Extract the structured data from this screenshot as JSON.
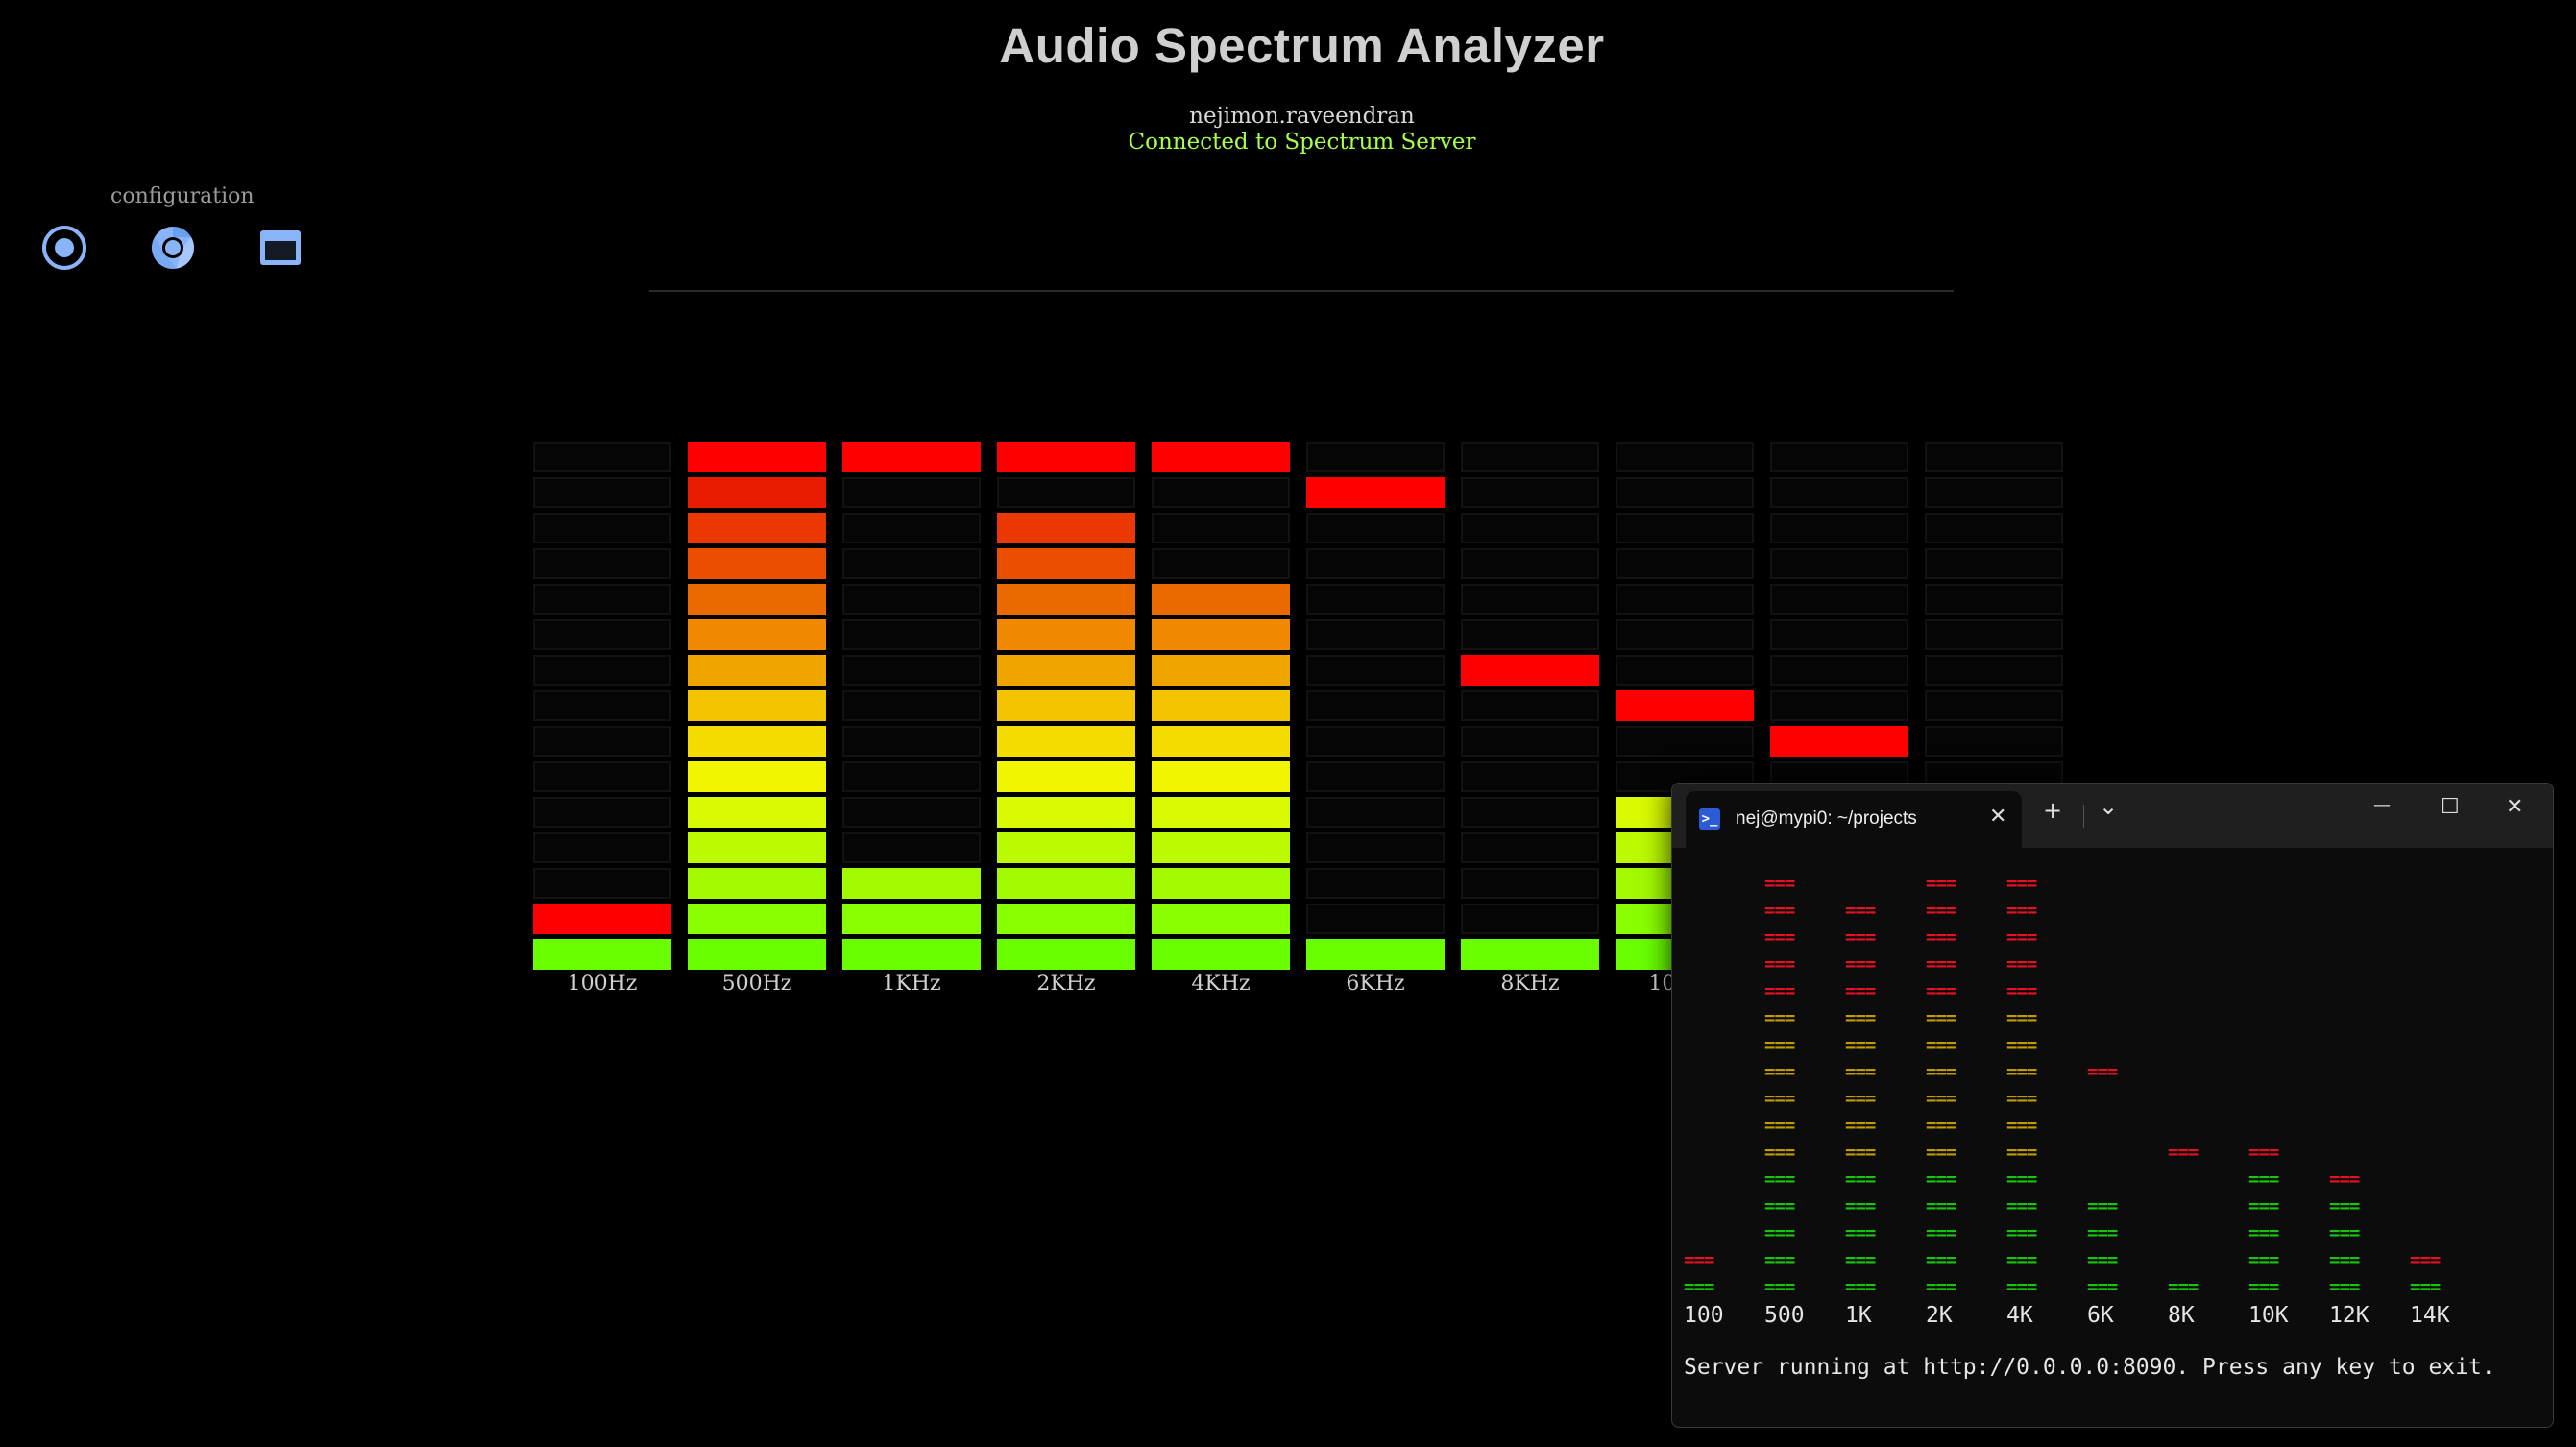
{
  "page": {
    "title": "Audio Spectrum Analyzer",
    "user": "nejimon.raveendran",
    "status": "Connected to Spectrum Server",
    "status_color": "#a6ff4d"
  },
  "config": {
    "label": "configuration",
    "icons": [
      "record-icon",
      "chrome-icon",
      "window-icon"
    ],
    "icon_color": "#8ab4f8"
  },
  "analyzer": {
    "segments_per_band": 15,
    "bands": [
      {
        "label": "100Hz",
        "level": 1,
        "peak": 2
      },
      {
        "label": "500Hz",
        "level": 15,
        "peak": 15
      },
      {
        "label": "1KHz",
        "level": 3,
        "peak": 15
      },
      {
        "label": "2KHz",
        "level": 13,
        "peak": 15
      },
      {
        "label": "4KHz",
        "level": 11,
        "peak": 15
      },
      {
        "label": "6KHz",
        "level": 1,
        "peak": 14
      },
      {
        "label": "8KHz",
        "level": 1,
        "peak": 9
      },
      {
        "label": "10KHz",
        "level": 5,
        "peak": 8
      },
      {
        "label": "12KHz",
        "level": 0,
        "peak": 7
      },
      {
        "label": "14KHz",
        "level": 0,
        "peak": 0
      }
    ],
    "peak_color": "#ff0000"
  },
  "terminal": {
    "tab_title": "nej@mypi0: ~/projects",
    "tab_icon": "powershell-icon",
    "buttons": {
      "new_tab": "+",
      "dropdown": "⌄",
      "minimize": "—",
      "maximize": "☐",
      "close": "✕",
      "tab_close": "✕"
    },
    "segment_text": "===",
    "colors": {
      "red": "#e81123",
      "yellow": "#c19c00",
      "green": "#16c60c",
      "text": "#e6e6e6"
    },
    "bands": [
      {
        "label": "100",
        "fill": 1,
        "peak": 2
      },
      {
        "label": "500",
        "fill": 15,
        "peak": 16
      },
      {
        "label": "1K",
        "fill": 15,
        "peak": 15
      },
      {
        "label": "2K",
        "fill": 16,
        "peak": 16
      },
      {
        "label": "4K",
        "fill": 15,
        "peak": 16
      },
      {
        "label": "6K",
        "fill": 4,
        "peak": 9
      },
      {
        "label": "8K",
        "fill": 1,
        "peak": 6
      },
      {
        "label": "10K",
        "fill": 5,
        "peak": 6
      },
      {
        "label": "12K",
        "fill": 4,
        "peak": 5
      },
      {
        "label": "14K",
        "fill": 1,
        "peak": 2
      }
    ],
    "server_line": "Server running at http://0.0.0.0:8090. Press any key to exit."
  }
}
